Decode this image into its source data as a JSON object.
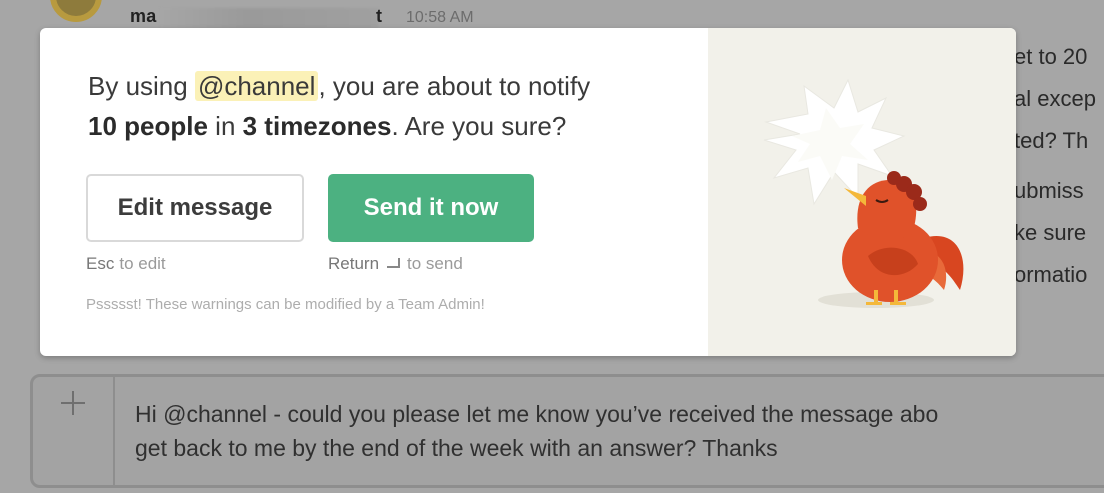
{
  "background": {
    "sender_prefix": "ma",
    "sender_suffix": "t",
    "timestamp": "10:58 AM",
    "message_fragments": [
      "et to 20",
      "al excep",
      "ted? Th",
      "ubmiss",
      "ke sure",
      "ormatio"
    ]
  },
  "modal": {
    "warning": {
      "part1": "By using ",
      "mention": "@channel",
      "part2": ", you are about to notify",
      "people": "10 people",
      "part3": " in ",
      "timezones": "3 timezones",
      "part4": ". Are you sure?"
    },
    "edit_button": "Edit message",
    "send_button": "Send it now",
    "edit_hint_key": "Esc",
    "edit_hint_text": "to edit",
    "send_hint_key": "Return",
    "send_hint_text": "to send",
    "footer_note": "Pssssst! These warnings can be modified by a Team Admin!"
  },
  "composer": {
    "text": "Hi @channel - could you please let me know you’ve received the message abo\nget back to me by the end of the week with an answer? Thanks"
  },
  "colors": {
    "send_button": "#4cb181",
    "mention_highlight": "#fbf1b7",
    "illustration_bg": "#f2f1ea",
    "rooster": "#e0522a"
  },
  "icons": [
    "plus-icon",
    "return-icon",
    "rooster-illustration"
  ]
}
